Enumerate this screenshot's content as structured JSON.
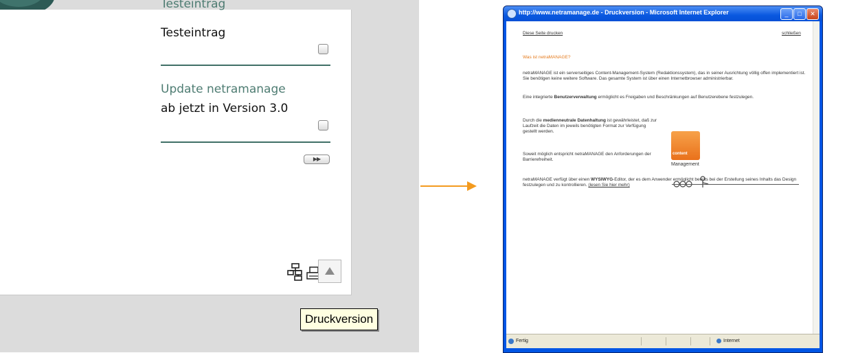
{
  "left_site": {
    "news": [
      {
        "title": "Testeintrag",
        "text": "Testeintrag"
      },
      {
        "title": "Update netramanage",
        "text": "ab jetzt in Version 3.0"
      }
    ],
    "archive_button_label": "▶▶",
    "tools": {
      "sitemap_icon": "sitemap-icon",
      "print_icon": "printer-icon",
      "top_icon": "arrow-up-icon"
    },
    "tooltip": "Druckversion"
  },
  "popup": {
    "title": "http://www.netramanage.de - Druckversion - Microsoft Internet Explorer",
    "window_buttons": {
      "minimize": "_",
      "maximize": "□",
      "close": "✕"
    },
    "print_link": "Diese Seite drucken",
    "close_link": "schließen",
    "heading": "Was ist netraMANAGE?",
    "para1": "netraMANAGE ist ein serverseitiges Content-Management-System (Redaktionssystem), das in seiner Ausrichtung völlig offen implementiert ist. Sie benötigen keine weitere Software. Das gesamte System ist über einen Internetbrowser administrierbar.",
    "para2_before": "Eine integrierte ",
    "para2_bold": "Benutzerverwaltung",
    "para2_after": " ermöglicht es Freigaben und Beschränkungen auf Benutzerebene festzulegen.",
    "para3_before": "Durch die ",
    "para3_bold": "medienneutrale Datenhaltung",
    "para3_after": " ist gewährleistet, daß zur Laufzeit die Daten im jeweils benötigten Format zur Verfügung gestellt werden.",
    "para4": "Soweit möglich entspricht netraMANAGE den Anforderungen der Barrierefreiheit.",
    "para5_before": "netraMANAGE verfügt über einen ",
    "para5_bold": "WYSIWYG",
    "para5_after": "-Editor, der es dem Anwender ermöglicht bereits bei der Erstellung seines Inhalts das Design festzulegen und zu kontrollieren.",
    "read_more": "(lesen Sie hier mehr)",
    "logo_square_text": "content",
    "logo_caption": "Management",
    "status_left": "Fertig",
    "status_zone": "Internet"
  },
  "colors": {
    "accent_orange": "#f39a1e",
    "site_green": "#4e7c72",
    "xp_blue": "#0055e5"
  }
}
